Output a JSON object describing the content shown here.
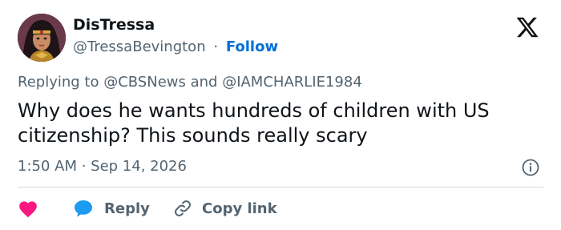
{
  "author": {
    "display_name": "DisTressa",
    "handle": "@TressaBevington",
    "separator": "·",
    "follow_label": "Follow"
  },
  "reply_context": {
    "prefix": "Replying to ",
    "mention_1": "@CBSNews",
    "conjunction": " and ",
    "mention_2": "@IAMCHARLIE1984"
  },
  "tweet": {
    "text": "Why does he wants hundreds of children with US citizenship? This sounds really scary",
    "timestamp": "1:50 AM · Sep 14, 2026"
  },
  "actions": {
    "reply_label": "Reply",
    "copy_link_label": "Copy link"
  },
  "colors": {
    "like": "#f91880",
    "reply": "#1d9bf0",
    "link": "#006fd6",
    "secondary_text": "#536471"
  },
  "icons": {
    "brand": "x-logo-icon",
    "info": "info-icon",
    "like": "heart-icon",
    "reply": "speech-bubble-icon",
    "copy": "link-icon"
  }
}
